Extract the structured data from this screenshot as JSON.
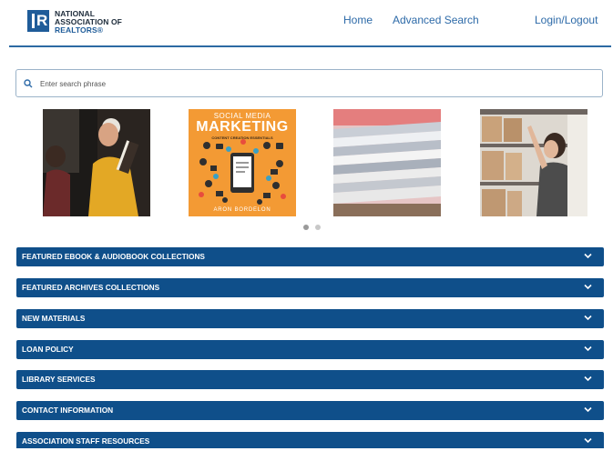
{
  "header": {
    "logo_line1": "NATIONAL",
    "logo_line2": "ASSOCIATION OF",
    "logo_line3": "REALTORS®",
    "nav": [
      {
        "label": "Home"
      },
      {
        "label": "Advanced Search"
      },
      {
        "label": "Login/Logout"
      }
    ]
  },
  "search": {
    "placeholder": "Enter search phrase",
    "value": ""
  },
  "carousel": {
    "book_title_line1": "SOCIAL MEDIA",
    "book_title_line2": "MARKETING",
    "book_subtitle": "CONTENT CREATION ESSENTIALS",
    "book_author": "ARON BORDELON",
    "active_slide": 1,
    "slide_count": 2
  },
  "accordion": [
    {
      "label": "FEATURED EBOOK & AUDIOBOOK COLLECTIONS"
    },
    {
      "label": "FEATURED ARCHIVES COLLECTIONS"
    },
    {
      "label": "NEW MATERIALS"
    },
    {
      "label": "LOAN POLICY"
    },
    {
      "label": "LIBRARY SERVICES"
    },
    {
      "label": "CONTACT INFORMATION"
    },
    {
      "label": "ASSOCIATION STAFF RESOURCES"
    }
  ],
  "colors": {
    "brand_blue": "#0f4f8a",
    "link_blue": "#2d6aa8",
    "book_orange": "#f39a34"
  }
}
